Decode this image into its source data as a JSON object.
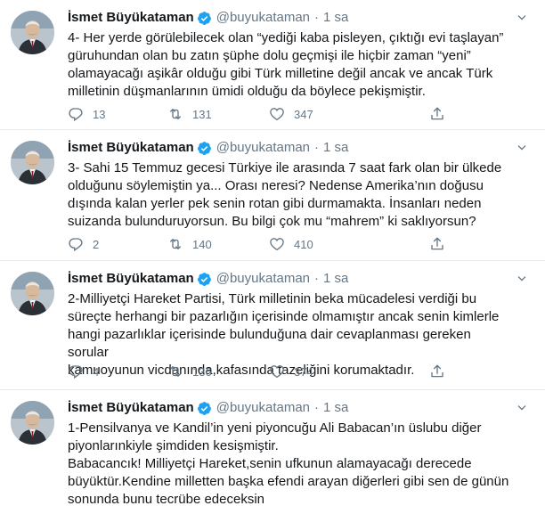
{
  "tweets": [
    {
      "name": "İsmet Büyükataman",
      "handle": "@buyukataman",
      "separator": "·",
      "time": "1 sa",
      "text": "4- Her yerde görülebilecek olan “yediği kaba pisleyen, çıktığı evi taşlayan”\ngüruhundan olan bu zatın şüphe dolu geçmişi ile hiçbir zaman “yeni”\nolamayacağı aşikâr olduğu gibi Türk milletine değil ancak ve ancak Türk\nmilletinin düşmanlarının ümidi olduğu da böylece pekişmiştir.",
      "replies": "13",
      "retweets": "131",
      "likes": "347"
    },
    {
      "name": "İsmet Büyükataman",
      "handle": "@buyukataman",
      "separator": "·",
      "time": "1 sa",
      "text": "3- Sahi 15 Temmuz gecesi Türkiye ile arasında 7 saat fark olan bir ülkede\nolduğunu söylemiştin ya... Orası neresi? Nedense Amerika’nın doğusu\ndışında kalan yerler pek senin rotan gibi durmamakta. İnsanları neden\nsuizanda bulunduruyorsun. Bu bilgi çok mu “mahrem” ki saklıyorsun?",
      "replies": "2",
      "retweets": "140",
      "likes": "410"
    },
    {
      "name": "İsmet Büyükataman",
      "handle": "@buyukataman",
      "separator": "·",
      "time": "1 sa",
      "text": "2-Milliyetçi Hareket Partisi, Türk milletinin beka mücadelesi verdiği bu\nsüreçte herhangi bir pazarlığın içerisinde olmamıştır ancak senin kimlerle\nhangi pazarlıklar içerisinde bulunduğuna dair cevaplanması gereken sorular\nkamuoyunun vicdanında,kafasında  tazeliğini korumaktadır.",
      "replies": "4",
      "retweets": "136",
      "likes": "374"
    },
    {
      "name": "İsmet Büyükataman",
      "handle": "@buyukataman",
      "separator": "·",
      "time": "1 sa",
      "text": "1-Pensilvanya ve Kandil’in yeni piyoncuğu Ali Babacan’ın üslubu diğer\npiyonlarınkiyle şimdiden kesişmiştir.\nBabacancık! Milliyetçi Hareket,senin ufkunun alamayacağı derecede\nbüyüktür.Kendine milletten başka efendi arayan diğerleri gibi sen de günün\nsonunda bunu tecrübe edeceksin"
    }
  ],
  "colors": {
    "text": "#14171a",
    "secondary": "#657786",
    "verified": "#1da1f2",
    "divider": "#e6ecf0"
  },
  "icons": [
    "verified-badge-icon",
    "caret-down-icon",
    "reply-icon",
    "retweet-icon",
    "like-icon",
    "share-icon"
  ]
}
